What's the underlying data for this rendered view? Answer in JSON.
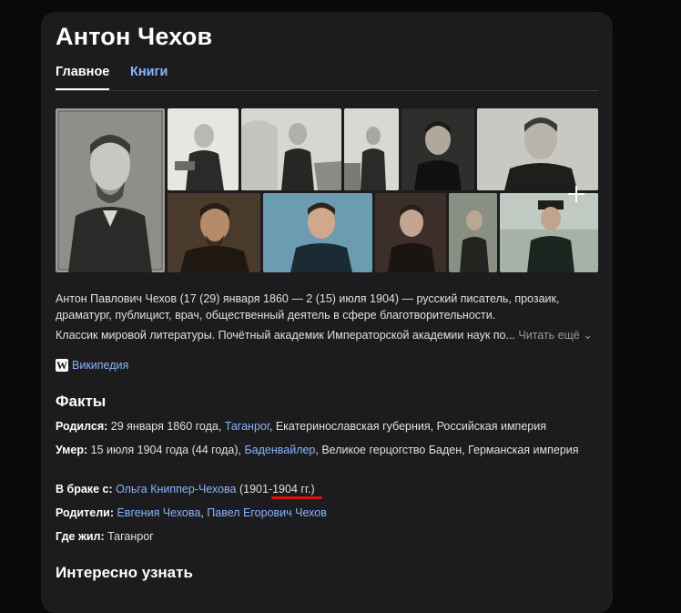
{
  "title": "Антон Чехов",
  "tabs": [
    {
      "label": "Главное",
      "active": true
    },
    {
      "label": "Книги",
      "active": false
    }
  ],
  "description": {
    "p1": "Антон Павлович Чехов (17 (29) января 1860 — 2 (15) июля 1904) — русский писатель, прозаик, драматург, публицист, врач, общественный деятель в сфере благотворительности.",
    "p2": "Классик мировой литературы. Почётный академик Императорской академии наук по...",
    "read_more": " Читать ещё ⌄"
  },
  "source": {
    "icon_letter": "W",
    "label": "Википедия"
  },
  "facts_heading": "Факты",
  "facts": {
    "born": {
      "label": "Родился:",
      "text1": " 29 января 1860 года, ",
      "link": "Таганрог",
      "text2": ", Екатеринославская губерния, Российская империя"
    },
    "died": {
      "label": "Умер:",
      "text1": " 15 июля 1904 года (44 года), ",
      "link": "Баденвайлер",
      "text2": ", Великое герцогство Баден, Германская империя"
    },
    "spouse": {
      "label": "В браке с:",
      "link": "Ольга Книппер-Чехова",
      "text2": " (1901-1904 гг.)"
    },
    "parents": {
      "label": "Родители:",
      "link1": "Евгения Чехова",
      "sep": ", ",
      "link2": "Павел Егорович Чехов"
    },
    "lived": {
      "label": "Где жил:",
      "text1": " Таганрог"
    }
  },
  "interesting_heading": "Интересно узнать",
  "colors": {
    "background": "#09090b",
    "card": "#1c1c1f",
    "link": "#8ab4f8",
    "annotation": "#e01010"
  }
}
